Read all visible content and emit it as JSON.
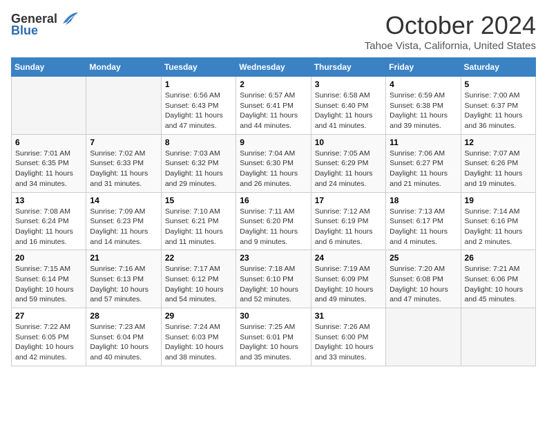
{
  "logo": {
    "general": "General",
    "blue": "Blue"
  },
  "title": {
    "month": "October 2024",
    "location": "Tahoe Vista, California, United States"
  },
  "calendar": {
    "headers": [
      "Sunday",
      "Monday",
      "Tuesday",
      "Wednesday",
      "Thursday",
      "Friday",
      "Saturday"
    ],
    "weeks": [
      [
        {
          "day": "",
          "info": ""
        },
        {
          "day": "",
          "info": ""
        },
        {
          "day": "1",
          "info": "Sunrise: 6:56 AM\nSunset: 6:43 PM\nDaylight: 11 hours and 47 minutes."
        },
        {
          "day": "2",
          "info": "Sunrise: 6:57 AM\nSunset: 6:41 PM\nDaylight: 11 hours and 44 minutes."
        },
        {
          "day": "3",
          "info": "Sunrise: 6:58 AM\nSunset: 6:40 PM\nDaylight: 11 hours and 41 minutes."
        },
        {
          "day": "4",
          "info": "Sunrise: 6:59 AM\nSunset: 6:38 PM\nDaylight: 11 hours and 39 minutes."
        },
        {
          "day": "5",
          "info": "Sunrise: 7:00 AM\nSunset: 6:37 PM\nDaylight: 11 hours and 36 minutes."
        }
      ],
      [
        {
          "day": "6",
          "info": "Sunrise: 7:01 AM\nSunset: 6:35 PM\nDaylight: 11 hours and 34 minutes."
        },
        {
          "day": "7",
          "info": "Sunrise: 7:02 AM\nSunset: 6:33 PM\nDaylight: 11 hours and 31 minutes."
        },
        {
          "day": "8",
          "info": "Sunrise: 7:03 AM\nSunset: 6:32 PM\nDaylight: 11 hours and 29 minutes."
        },
        {
          "day": "9",
          "info": "Sunrise: 7:04 AM\nSunset: 6:30 PM\nDaylight: 11 hours and 26 minutes."
        },
        {
          "day": "10",
          "info": "Sunrise: 7:05 AM\nSunset: 6:29 PM\nDaylight: 11 hours and 24 minutes."
        },
        {
          "day": "11",
          "info": "Sunrise: 7:06 AM\nSunset: 6:27 PM\nDaylight: 11 hours and 21 minutes."
        },
        {
          "day": "12",
          "info": "Sunrise: 7:07 AM\nSunset: 6:26 PM\nDaylight: 11 hours and 19 minutes."
        }
      ],
      [
        {
          "day": "13",
          "info": "Sunrise: 7:08 AM\nSunset: 6:24 PM\nDaylight: 11 hours and 16 minutes."
        },
        {
          "day": "14",
          "info": "Sunrise: 7:09 AM\nSunset: 6:23 PM\nDaylight: 11 hours and 14 minutes."
        },
        {
          "day": "15",
          "info": "Sunrise: 7:10 AM\nSunset: 6:21 PM\nDaylight: 11 hours and 11 minutes."
        },
        {
          "day": "16",
          "info": "Sunrise: 7:11 AM\nSunset: 6:20 PM\nDaylight: 11 hours and 9 minutes."
        },
        {
          "day": "17",
          "info": "Sunrise: 7:12 AM\nSunset: 6:19 PM\nDaylight: 11 hours and 6 minutes."
        },
        {
          "day": "18",
          "info": "Sunrise: 7:13 AM\nSunset: 6:17 PM\nDaylight: 11 hours and 4 minutes."
        },
        {
          "day": "19",
          "info": "Sunrise: 7:14 AM\nSunset: 6:16 PM\nDaylight: 11 hours and 2 minutes."
        }
      ],
      [
        {
          "day": "20",
          "info": "Sunrise: 7:15 AM\nSunset: 6:14 PM\nDaylight: 10 hours and 59 minutes."
        },
        {
          "day": "21",
          "info": "Sunrise: 7:16 AM\nSunset: 6:13 PM\nDaylight: 10 hours and 57 minutes."
        },
        {
          "day": "22",
          "info": "Sunrise: 7:17 AM\nSunset: 6:12 PM\nDaylight: 10 hours and 54 minutes."
        },
        {
          "day": "23",
          "info": "Sunrise: 7:18 AM\nSunset: 6:10 PM\nDaylight: 10 hours and 52 minutes."
        },
        {
          "day": "24",
          "info": "Sunrise: 7:19 AM\nSunset: 6:09 PM\nDaylight: 10 hours and 49 minutes."
        },
        {
          "day": "25",
          "info": "Sunrise: 7:20 AM\nSunset: 6:08 PM\nDaylight: 10 hours and 47 minutes."
        },
        {
          "day": "26",
          "info": "Sunrise: 7:21 AM\nSunset: 6:06 PM\nDaylight: 10 hours and 45 minutes."
        }
      ],
      [
        {
          "day": "27",
          "info": "Sunrise: 7:22 AM\nSunset: 6:05 PM\nDaylight: 10 hours and 42 minutes."
        },
        {
          "day": "28",
          "info": "Sunrise: 7:23 AM\nSunset: 6:04 PM\nDaylight: 10 hours and 40 minutes."
        },
        {
          "day": "29",
          "info": "Sunrise: 7:24 AM\nSunset: 6:03 PM\nDaylight: 10 hours and 38 minutes."
        },
        {
          "day": "30",
          "info": "Sunrise: 7:25 AM\nSunset: 6:01 PM\nDaylight: 10 hours and 35 minutes."
        },
        {
          "day": "31",
          "info": "Sunrise: 7:26 AM\nSunset: 6:00 PM\nDaylight: 10 hours and 33 minutes."
        },
        {
          "day": "",
          "info": ""
        },
        {
          "day": "",
          "info": ""
        }
      ]
    ]
  }
}
